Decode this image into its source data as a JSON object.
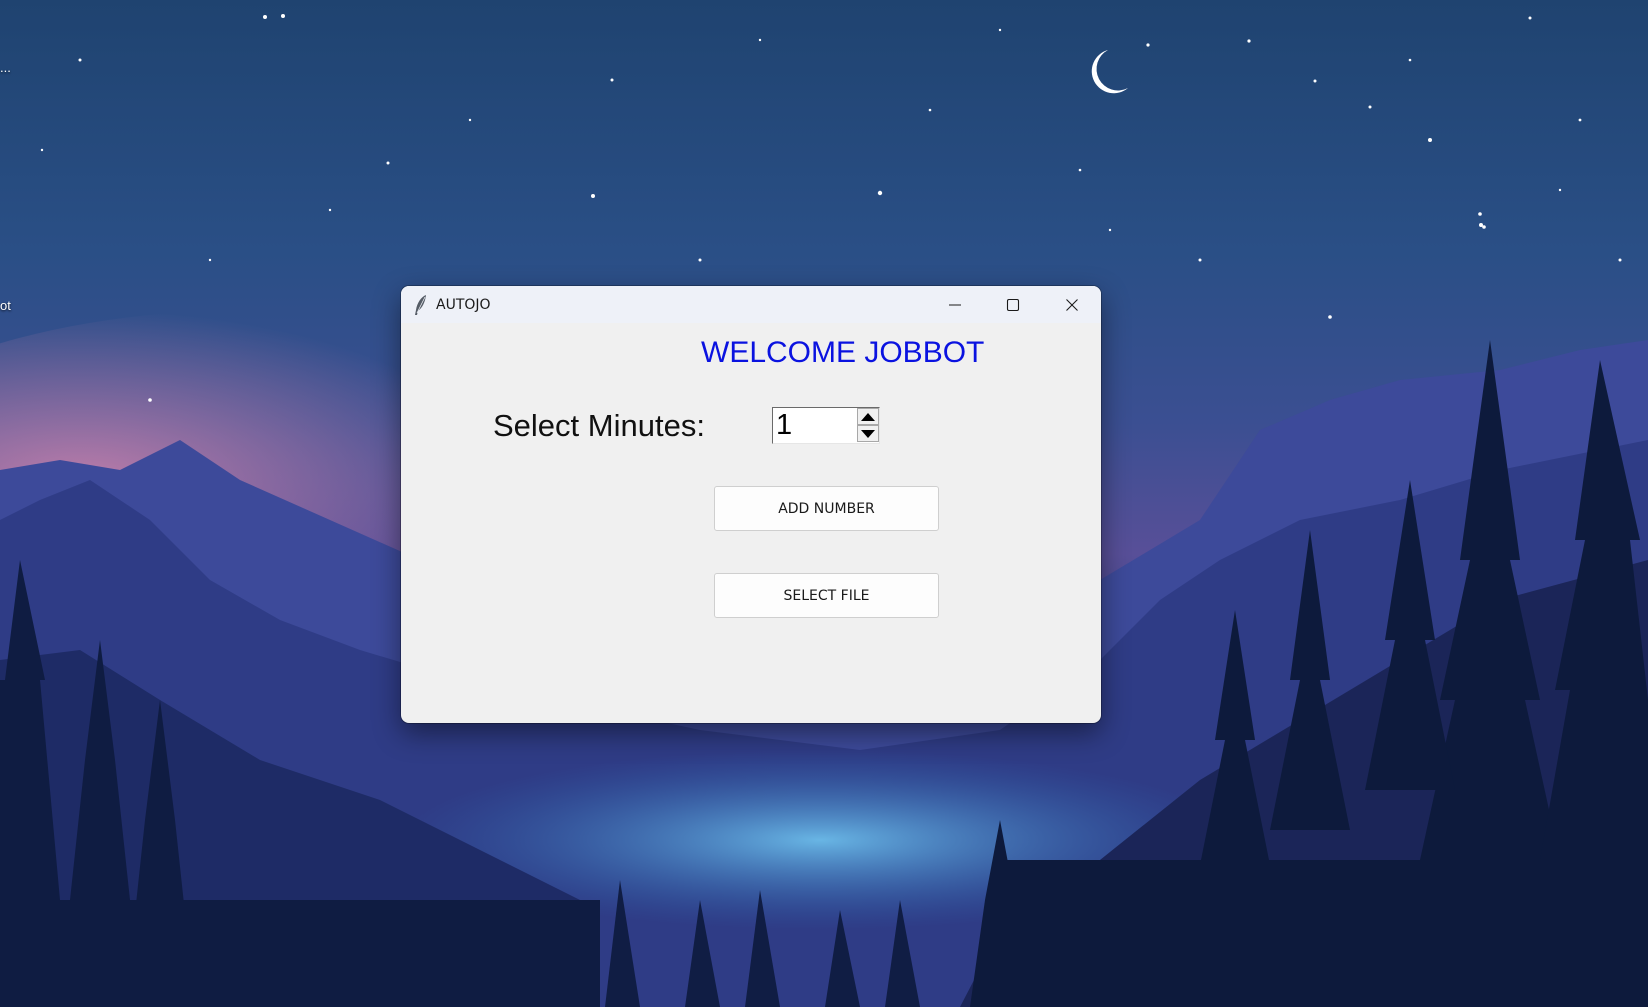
{
  "desktop": {
    "icon_label_1": "...",
    "icon_label_2": "ot"
  },
  "window": {
    "title": "AUTOJO",
    "app_icon": "feather-icon",
    "minimize_icon": "minimize-icon",
    "maximize_icon": "maximize-icon",
    "close_icon": "close-icon"
  },
  "main": {
    "heading": "WELCOME JOBBOT",
    "heading_color": "#0a12e0",
    "minutes_label": "Select Minutes:",
    "minutes_value": "1",
    "add_number_label": "ADD NUMBER",
    "select_file_label": "SELECT FILE"
  }
}
